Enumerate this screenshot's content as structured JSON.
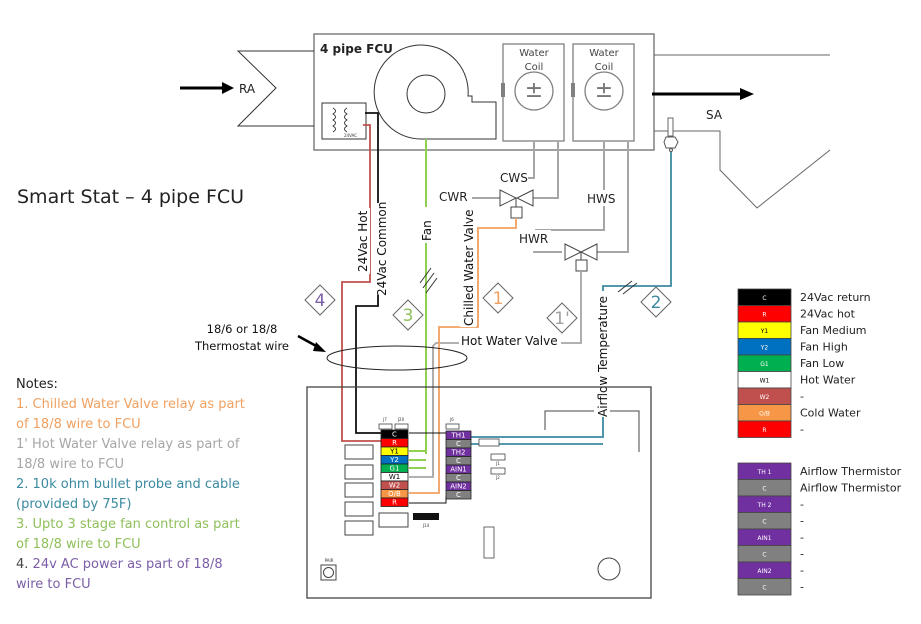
{
  "title": "Smart Stat – 4 pipe FCU",
  "fcu": {
    "label": "4 pipe FCU",
    "ra_label": "RA",
    "sa_label": "SA",
    "transformer_label": "24VAC",
    "coils": [
      {
        "line1": "Water",
        "line2": "Coil"
      },
      {
        "line1": "Water",
        "line2": "Coil"
      }
    ]
  },
  "piping": {
    "cws": "CWS",
    "cwr": "CWR",
    "hws": "HWS",
    "hwr": "HWR"
  },
  "wire_labels": {
    "hot": "24Vac Hot",
    "common": "24Vac Common",
    "fan": "Fan",
    "chilled_valve": "Chilled Water Valve",
    "hot_valve": "Hot Water Valve",
    "airflow_temp": "Airflow Temperature",
    "thermostat_wire_line1": "18/6 or 18/8",
    "thermostat_wire_line2": "Thermostat wire"
  },
  "markers": [
    {
      "id": "4",
      "color": "#7b5ea7"
    },
    {
      "id": "3",
      "color": "#8fbf5a"
    },
    {
      "id": "1",
      "color": "#f0a060"
    },
    {
      "id": "1'",
      "color": "#a0a0a0"
    },
    {
      "id": "2",
      "color": "#3b8aa0"
    }
  ],
  "notes": {
    "heading": "Notes:",
    "items": [
      {
        "lines": [
          "1. Chilled Water Valve relay as part",
          "of 18/8 wire to FCU"
        ],
        "color": "#f0a060"
      },
      {
        "lines": [
          "1' Hot Water Valve relay as part of",
          "18/8 wire to FCU"
        ],
        "color": "#a6a6a6"
      },
      {
        "lines": [
          "2. 10k ohm bullet probe and cable",
          "(provided by 75F)"
        ],
        "color": "#3b8aa0"
      },
      {
        "lines": [
          "3. Upto 3 stage fan control as part",
          "of 18/8 wire to FCU"
        ],
        "color": "#8fbf5a"
      },
      {
        "prefix": "4. ",
        "lines": [
          "24v AC power as part of 18/8",
          "wire to FCU"
        ],
        "color": "#7b5ea7"
      }
    ]
  },
  "board": {
    "connector_labels": [
      "J7",
      "J20",
      "J6",
      "J14",
      "J1",
      "J2",
      "PAIR"
    ],
    "left_terminals": [
      {
        "code": "C",
        "bg": "#000000",
        "fg": "#ffffff"
      },
      {
        "code": "R",
        "bg": "#ff0000",
        "fg": "#ffffff"
      },
      {
        "code": "Y1",
        "bg": "#ffff00",
        "fg": "#000000"
      },
      {
        "code": "Y2",
        "bg": "#0070c0",
        "fg": "#ffffff"
      },
      {
        "code": "G1",
        "bg": "#00b050",
        "fg": "#ffffff"
      },
      {
        "code": "W1",
        "bg": "#ffffff",
        "fg": "#000000"
      },
      {
        "code": "W2",
        "bg": "#c0504d",
        "fg": "#ffffff"
      },
      {
        "code": "O/B",
        "bg": "#f79646",
        "fg": "#ffffff"
      },
      {
        "code": "R",
        "bg": "#ff0000",
        "fg": "#ffffff"
      }
    ],
    "right_terminals": [
      {
        "code": "TH1",
        "bg": "#7030a0",
        "fg": "#ffffff"
      },
      {
        "code": "C",
        "bg": "#808080",
        "fg": "#ffffff"
      },
      {
        "code": "TH2",
        "bg": "#7030a0",
        "fg": "#ffffff"
      },
      {
        "code": "C",
        "bg": "#808080",
        "fg": "#ffffff"
      },
      {
        "code": "AIN1",
        "bg": "#7030a0",
        "fg": "#ffffff"
      },
      {
        "code": "C",
        "bg": "#808080",
        "fg": "#ffffff"
      },
      {
        "code": "AIN2",
        "bg": "#7030a0",
        "fg": "#ffffff"
      },
      {
        "code": "C",
        "bg": "#808080",
        "fg": "#ffffff"
      }
    ]
  },
  "legend_top": [
    {
      "code": "C",
      "bg": "#000000",
      "fg": "#ffffff",
      "desc": "24Vac return"
    },
    {
      "code": "R",
      "bg": "#ff0000",
      "fg": "#ffffff",
      "desc": "24Vac hot"
    },
    {
      "code": "Y1",
      "bg": "#ffff00",
      "fg": "#000000",
      "desc": "Fan Medium"
    },
    {
      "code": "Y2",
      "bg": "#0070c0",
      "fg": "#ffffff",
      "desc": "Fan High"
    },
    {
      "code": "G1",
      "bg": "#00b050",
      "fg": "#ffffff",
      "desc": "Fan Low"
    },
    {
      "code": "W1",
      "bg": "#ffffff",
      "fg": "#000000",
      "desc": "Hot Water"
    },
    {
      "code": "W2",
      "bg": "#c0504d",
      "fg": "#ffffff",
      "desc": "-"
    },
    {
      "code": "O/B",
      "bg": "#f79646",
      "fg": "#ffffff",
      "desc": "Cold Water"
    },
    {
      "code": "R",
      "bg": "#ff0000",
      "fg": "#ffffff",
      "desc": "-"
    }
  ],
  "legend_bottom": [
    {
      "code": "TH 1",
      "bg": "#7030a0",
      "fg": "#ffffff",
      "desc": "Airflow Thermistor"
    },
    {
      "code": "C",
      "bg": "#808080",
      "fg": "#ffffff",
      "desc": "Airflow Thermistor"
    },
    {
      "code": "TH 2",
      "bg": "#7030a0",
      "fg": "#ffffff",
      "desc": "-"
    },
    {
      "code": "C",
      "bg": "#808080",
      "fg": "#ffffff",
      "desc": "-"
    },
    {
      "code": "AIN1",
      "bg": "#7030a0",
      "fg": "#ffffff",
      "desc": "-"
    },
    {
      "code": "C",
      "bg": "#808080",
      "fg": "#ffffff",
      "desc": "-"
    },
    {
      "code": "AIN2",
      "bg": "#7030a0",
      "fg": "#ffffff",
      "desc": "-"
    },
    {
      "code": "C",
      "bg": "#808080",
      "fg": "#ffffff",
      "desc": "-"
    }
  ]
}
